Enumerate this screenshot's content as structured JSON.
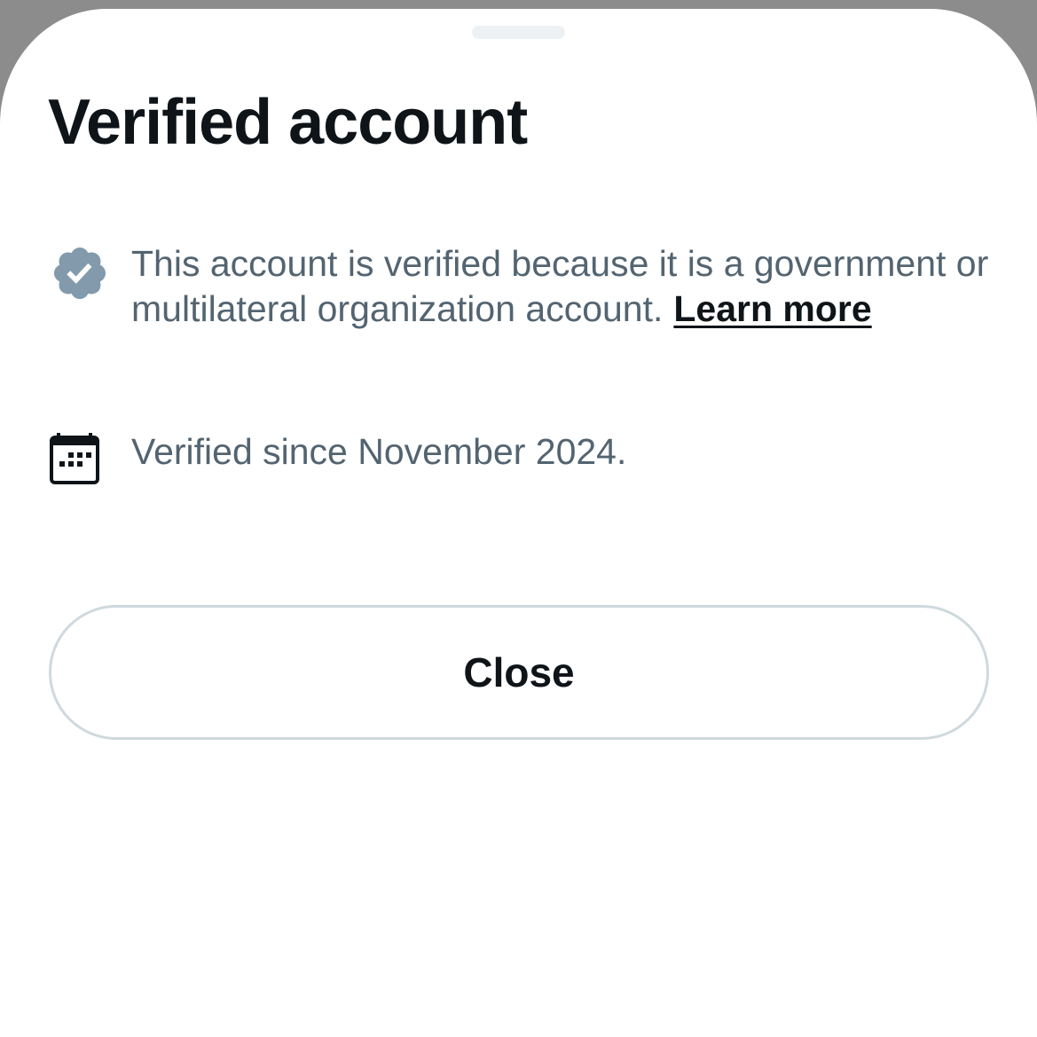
{
  "sheet": {
    "title": "Verified account"
  },
  "verification": {
    "description": "This account is verified because it is a government or multilateral organization account.",
    "learn_more_label": "Learn more",
    "badge_icon": "verified-badge-icon",
    "badge_color": "#829aab"
  },
  "verified_since": {
    "text": "Verified since November 2024.",
    "icon": "calendar-icon"
  },
  "actions": {
    "close_label": "Close"
  },
  "colors": {
    "title": "#0f1419",
    "body_text": "#536471",
    "button_border": "#cfd9de",
    "backdrop": "#8c8c8c",
    "sheet": "#ffffff"
  }
}
